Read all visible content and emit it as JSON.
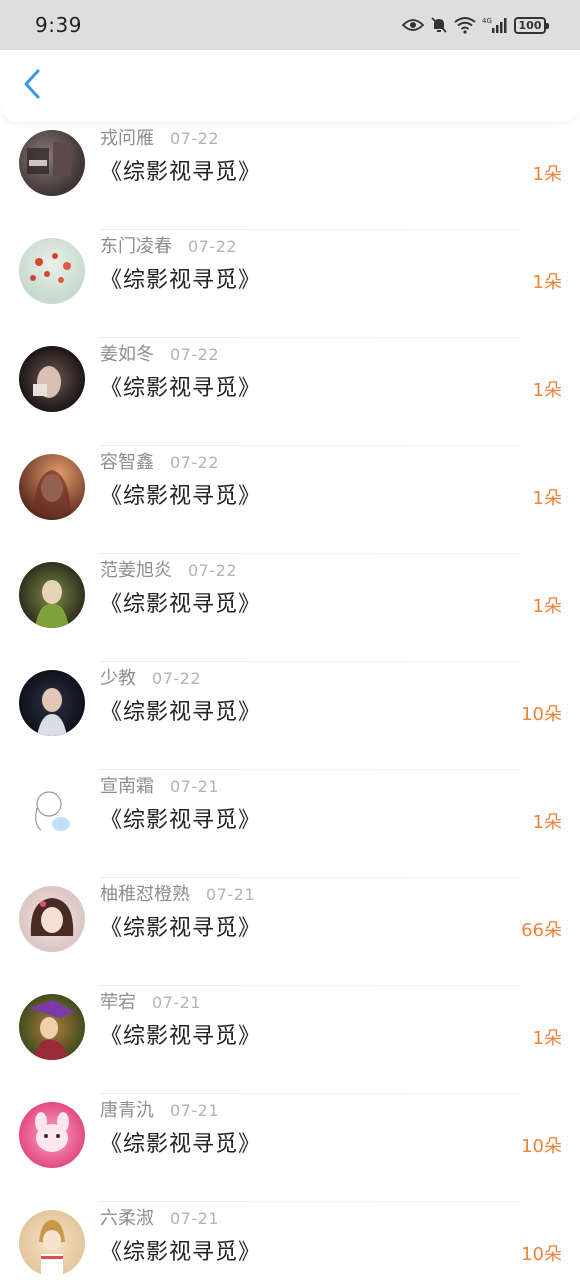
{
  "status_bar": {
    "time": "9:39",
    "battery": "100",
    "icons": [
      "eye-icon",
      "mute-bell-icon",
      "wifi-icon",
      "signal-4g-icon",
      "battery-icon"
    ]
  },
  "header": {
    "back_icon": "chevron-left-icon",
    "accent_color": "#2f9be6"
  },
  "colors": {
    "gift_count": "#f0823a",
    "name": "#8e8e8e",
    "date": "#b3b3b3",
    "book_title": "#222222"
  },
  "rows": [
    {
      "name": "戎问雁",
      "date": "07-22",
      "book": "《综影视寻觅》",
      "gift": "1朵"
    },
    {
      "name": "东门凌春",
      "date": "07-22",
      "book": "《综影视寻觅》",
      "gift": "1朵"
    },
    {
      "name": "姜如冬",
      "date": "07-22",
      "book": "《综影视寻觅》",
      "gift": "1朵"
    },
    {
      "name": "容智鑫",
      "date": "07-22",
      "book": "《综影视寻觅》",
      "gift": "1朵"
    },
    {
      "name": "范姜旭炎",
      "date": "07-22",
      "book": "《综影视寻觅》",
      "gift": "1朵"
    },
    {
      "name": "少教",
      "date": "07-22",
      "book": "《综影视寻觅》",
      "gift": "10朵"
    },
    {
      "name": "宣南霜",
      "date": "07-21",
      "book": "《综影视寻觅》",
      "gift": "1朵"
    },
    {
      "name": "柚稚怼橙熟",
      "date": "07-21",
      "book": "《综影视寻觅》",
      "gift": "66朵"
    },
    {
      "name": "荦宕",
      "date": "07-21",
      "book": "《综影视寻觅》",
      "gift": "1朵"
    },
    {
      "name": "唐青氿",
      "date": "07-21",
      "book": "《综影视寻觅》",
      "gift": "10朵"
    },
    {
      "name": "六柔淑",
      "date": "07-21",
      "book": "《综影视寻觅》",
      "gift": "10朵"
    }
  ]
}
